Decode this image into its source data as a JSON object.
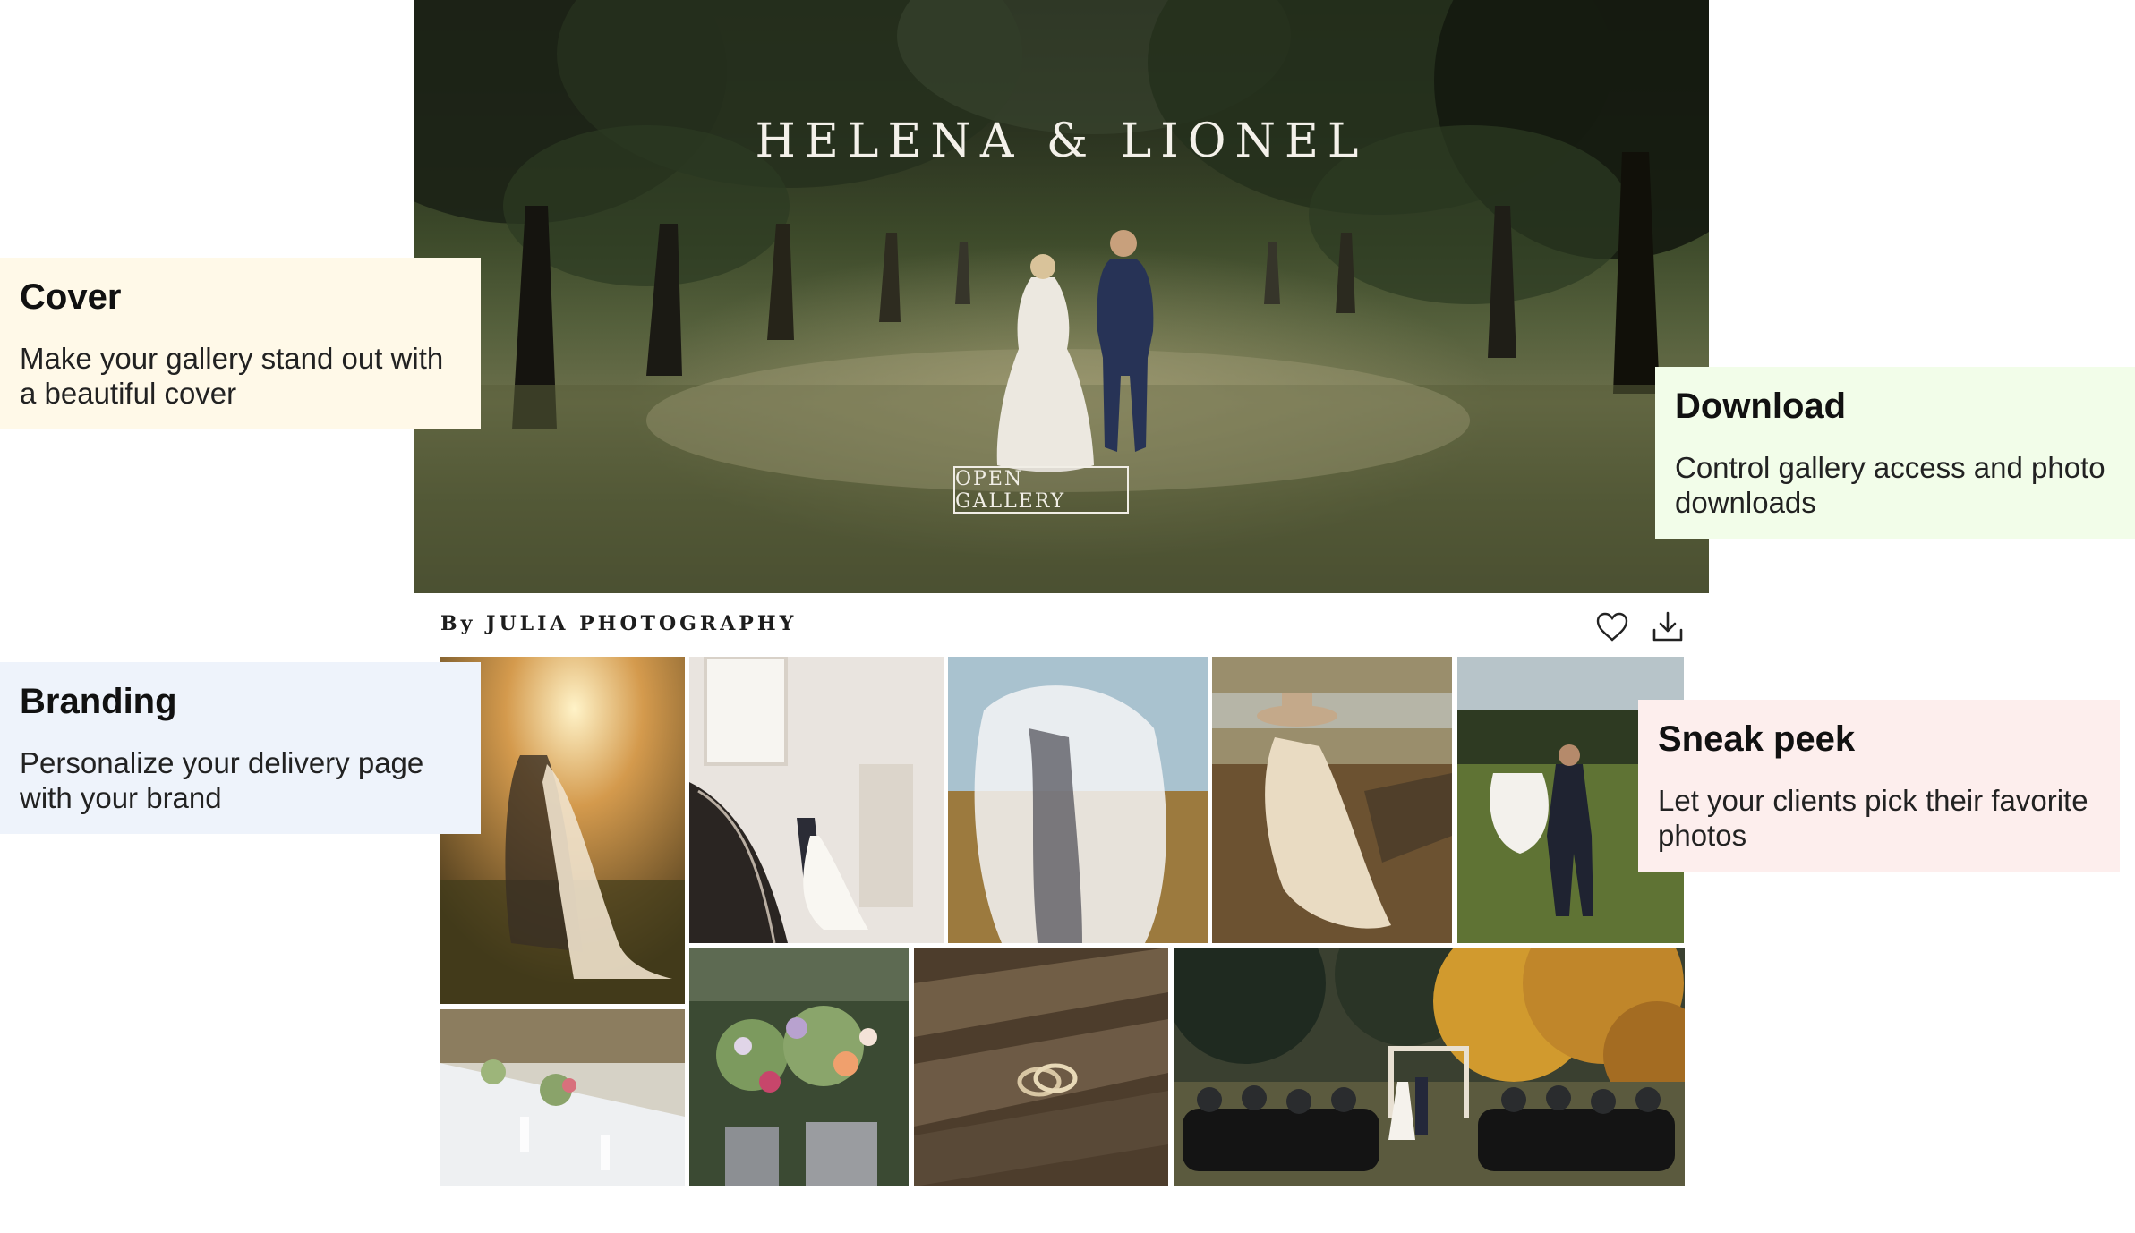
{
  "cover": {
    "title": "HELENA & LIONEL",
    "button_label": "OPEN GALLERY"
  },
  "bar": {
    "byline": "By JULIA PHOTOGRAPHY",
    "icons": [
      "heart-icon",
      "download-icon"
    ]
  },
  "features": [
    {
      "title": "Cover",
      "description": "Make your gallery stand out with a beautiful cover",
      "color": "#fff9e8"
    },
    {
      "title": "Download",
      "description": "Control gallery access and photo downloads",
      "color": "#f2fde9"
    },
    {
      "title": "Branding",
      "description": "Personalize your delivery page with your brand",
      "color": "#eef3fb"
    },
    {
      "title": "Sneak peek",
      "description": "Let your clients pick their favorite photos",
      "color": "#fdeeed"
    }
  ],
  "gallery": {
    "photos": [
      {
        "name": "sunset-couple-photo",
        "description": "couple embracing at sunset"
      },
      {
        "name": "staircase-couple-photo",
        "description": "couple on spiral staircase"
      },
      {
        "name": "veil-kiss-photo",
        "description": "couple under veil in field"
      },
      {
        "name": "hat-bride-photo",
        "description": "bride in hat by lake"
      },
      {
        "name": "field-dance-photo",
        "description": "couple dancing in meadow"
      },
      {
        "name": "table-setting-photo",
        "description": "reception table setting"
      },
      {
        "name": "flower-bouquet-photo",
        "description": "flower arrangements"
      },
      {
        "name": "rings-photo",
        "description": "wedding rings on wood"
      },
      {
        "name": "ceremony-photo",
        "description": "outdoor autumn ceremony"
      }
    ]
  }
}
